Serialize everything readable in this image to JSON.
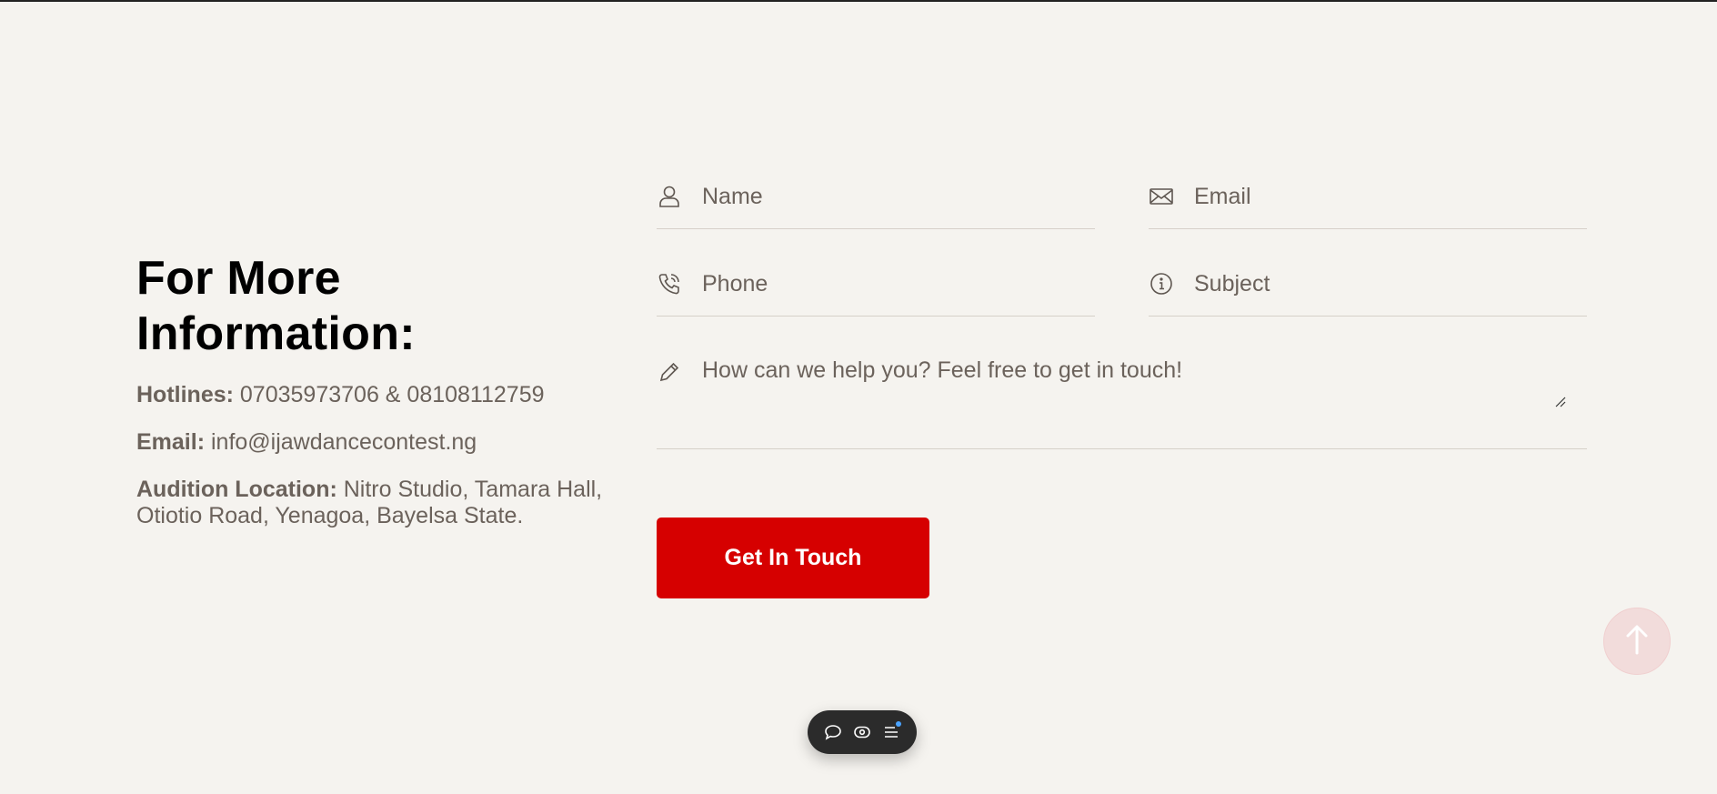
{
  "info": {
    "heading": "For More Information:",
    "hotlines_label": "Hotlines:",
    "hotlines_value": "07035973706 & 08108112759",
    "email_label": "Email:",
    "email_value": "info@ijawdancecontest.ng",
    "location_label": "Audition Location:",
    "location_value": "Nitro Studio, Tamara Hall, Otiotio Road, Yenagoa, Bayelsa State."
  },
  "form": {
    "name_placeholder": "Name",
    "email_placeholder": "Email",
    "phone_placeholder": "Phone",
    "subject_placeholder": "Subject",
    "message_placeholder": "How can we help you? Feel free to get in touch!",
    "submit_label": "Get In Touch",
    "icons": {
      "name": "user-icon",
      "email": "envelope-icon",
      "phone": "phone-icon",
      "subject": "info-icon",
      "message": "pencil-icon"
    }
  },
  "scroll_to_top": {
    "icon": "arrow-up-icon"
  },
  "floating_toolbar": {
    "items": [
      {
        "icon": "comment-icon"
      },
      {
        "icon": "eye-icon"
      },
      {
        "icon": "menu-icon"
      }
    ]
  },
  "colors": {
    "background": "#f5f3ef",
    "accent": "#d60000",
    "text": "#6b625b",
    "heading": "#000000"
  }
}
